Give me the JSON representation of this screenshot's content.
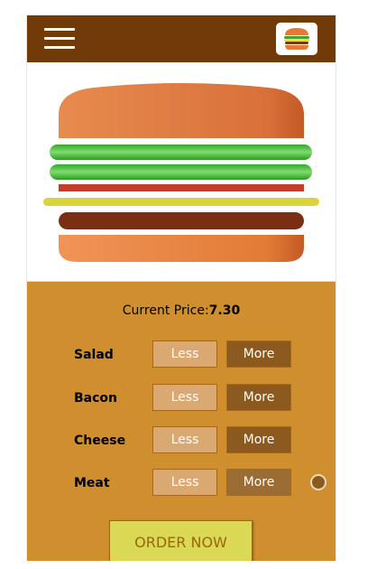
{
  "toolbar": {
    "menu_icon": "hamburger-menu-icon",
    "logo_icon": "burger-logo-icon",
    "background_color": "#703b09"
  },
  "burger": {
    "ingredients": [
      "salad",
      "salad",
      "bacon",
      "cheese",
      "meat"
    ],
    "colors": {
      "bread": "#e27b36",
      "salad": "#228c1d",
      "bacon": "#bf3813",
      "cheese": "#d4d42a",
      "meat": "#7f3608"
    }
  },
  "controls": {
    "price_label": "Current Price:",
    "price_value": "7.30",
    "rows": [
      {
        "label": "Salad",
        "less": "Less",
        "more": "More"
      },
      {
        "label": "Bacon",
        "less": "Less",
        "more": "More"
      },
      {
        "label": "Cheese",
        "less": "Less",
        "more": "More"
      },
      {
        "label": "Meat",
        "less": "Less",
        "more": "More"
      }
    ],
    "order_label": "ORDER NOW",
    "background_color": "#cf8f2e"
  }
}
